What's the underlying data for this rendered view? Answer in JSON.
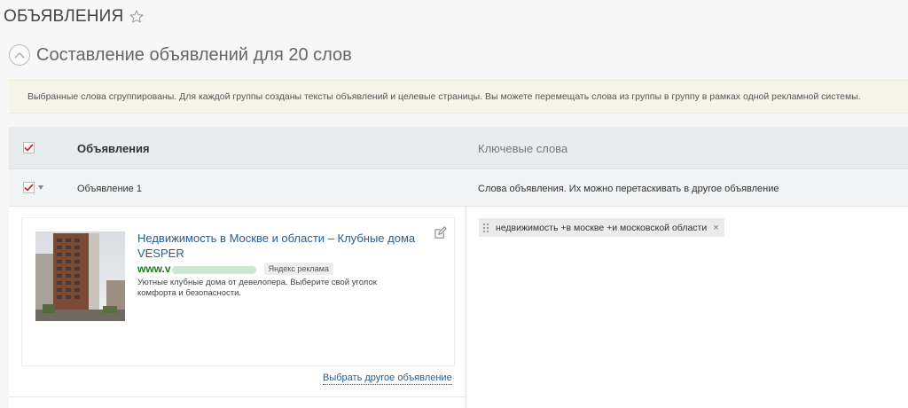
{
  "page": {
    "title": "ОБЪЯВЛЕНИЯ",
    "star_icon": "star-outline-icon"
  },
  "section": {
    "title": "Составление объявлений для 20 слов",
    "collapse_icon": "chevron-up-circle-icon"
  },
  "info": {
    "text": "Выбранные слова сгруппированы. Для каждой группы созданы тексты объявлений и целевые страницы. Вы можете перемещать слова из группы в группу в рамках одной рекламной системы."
  },
  "table": {
    "header": {
      "ads_label": "Объявления",
      "keywords_label": "Ключевые слова"
    },
    "group": {
      "label": "Объявление 1",
      "keywords_hint": "Слова объявления. Их можно перетаскивать в другое объявление"
    }
  },
  "ad": {
    "title": "Недвижимость в Москве и области – Клубные дома VESPER",
    "url_prefix": "www.v",
    "badge": "Яндекс реклама",
    "description": "Уютные клубные дома от девелопера. Выберите свой уголок комфорта и безопасности.",
    "choose_other": "Выбрать другое объявление"
  },
  "keywords": [
    {
      "text": "недвижимость +в москве +и московской области",
      "remove": "×"
    }
  ],
  "colors": {
    "accent_check": "#c8283c",
    "link": "#2a5d8c",
    "url_green": "#1e7a1e",
    "banner_bg": "#f5f4e8"
  }
}
